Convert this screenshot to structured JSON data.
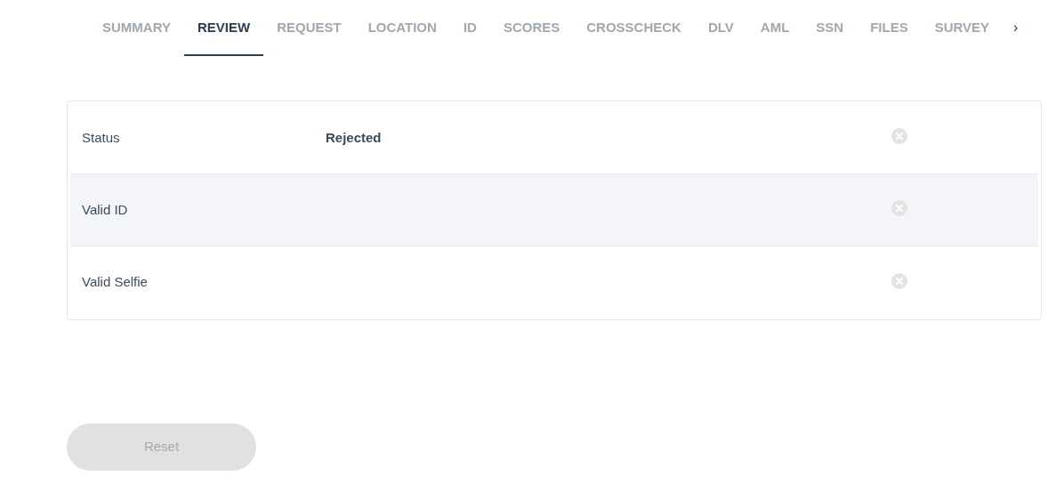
{
  "tabs": [
    {
      "label": "SUMMARY",
      "selected": false
    },
    {
      "label": "REVIEW",
      "selected": true
    },
    {
      "label": "REQUEST",
      "selected": false
    },
    {
      "label": "LOCATION",
      "selected": false
    },
    {
      "label": "ID",
      "selected": false
    },
    {
      "label": "SCORES",
      "selected": false
    },
    {
      "label": "CROSSCHECK",
      "selected": false
    },
    {
      "label": "DLV",
      "selected": false
    },
    {
      "label": "AML",
      "selected": false
    },
    {
      "label": "SSN",
      "selected": false
    },
    {
      "label": "FILES",
      "selected": false
    },
    {
      "label": "SURVEY",
      "selected": false
    }
  ],
  "tabs_scroll": "›",
  "review_rows": [
    {
      "label": "Status",
      "value": "Rejected",
      "hovered": false
    },
    {
      "label": "Valid ID",
      "hovered": true
    },
    {
      "label": "Valid Selfie",
      "hovered": false
    }
  ],
  "reset_button": {
    "label": "Reset",
    "disabled": true
  }
}
